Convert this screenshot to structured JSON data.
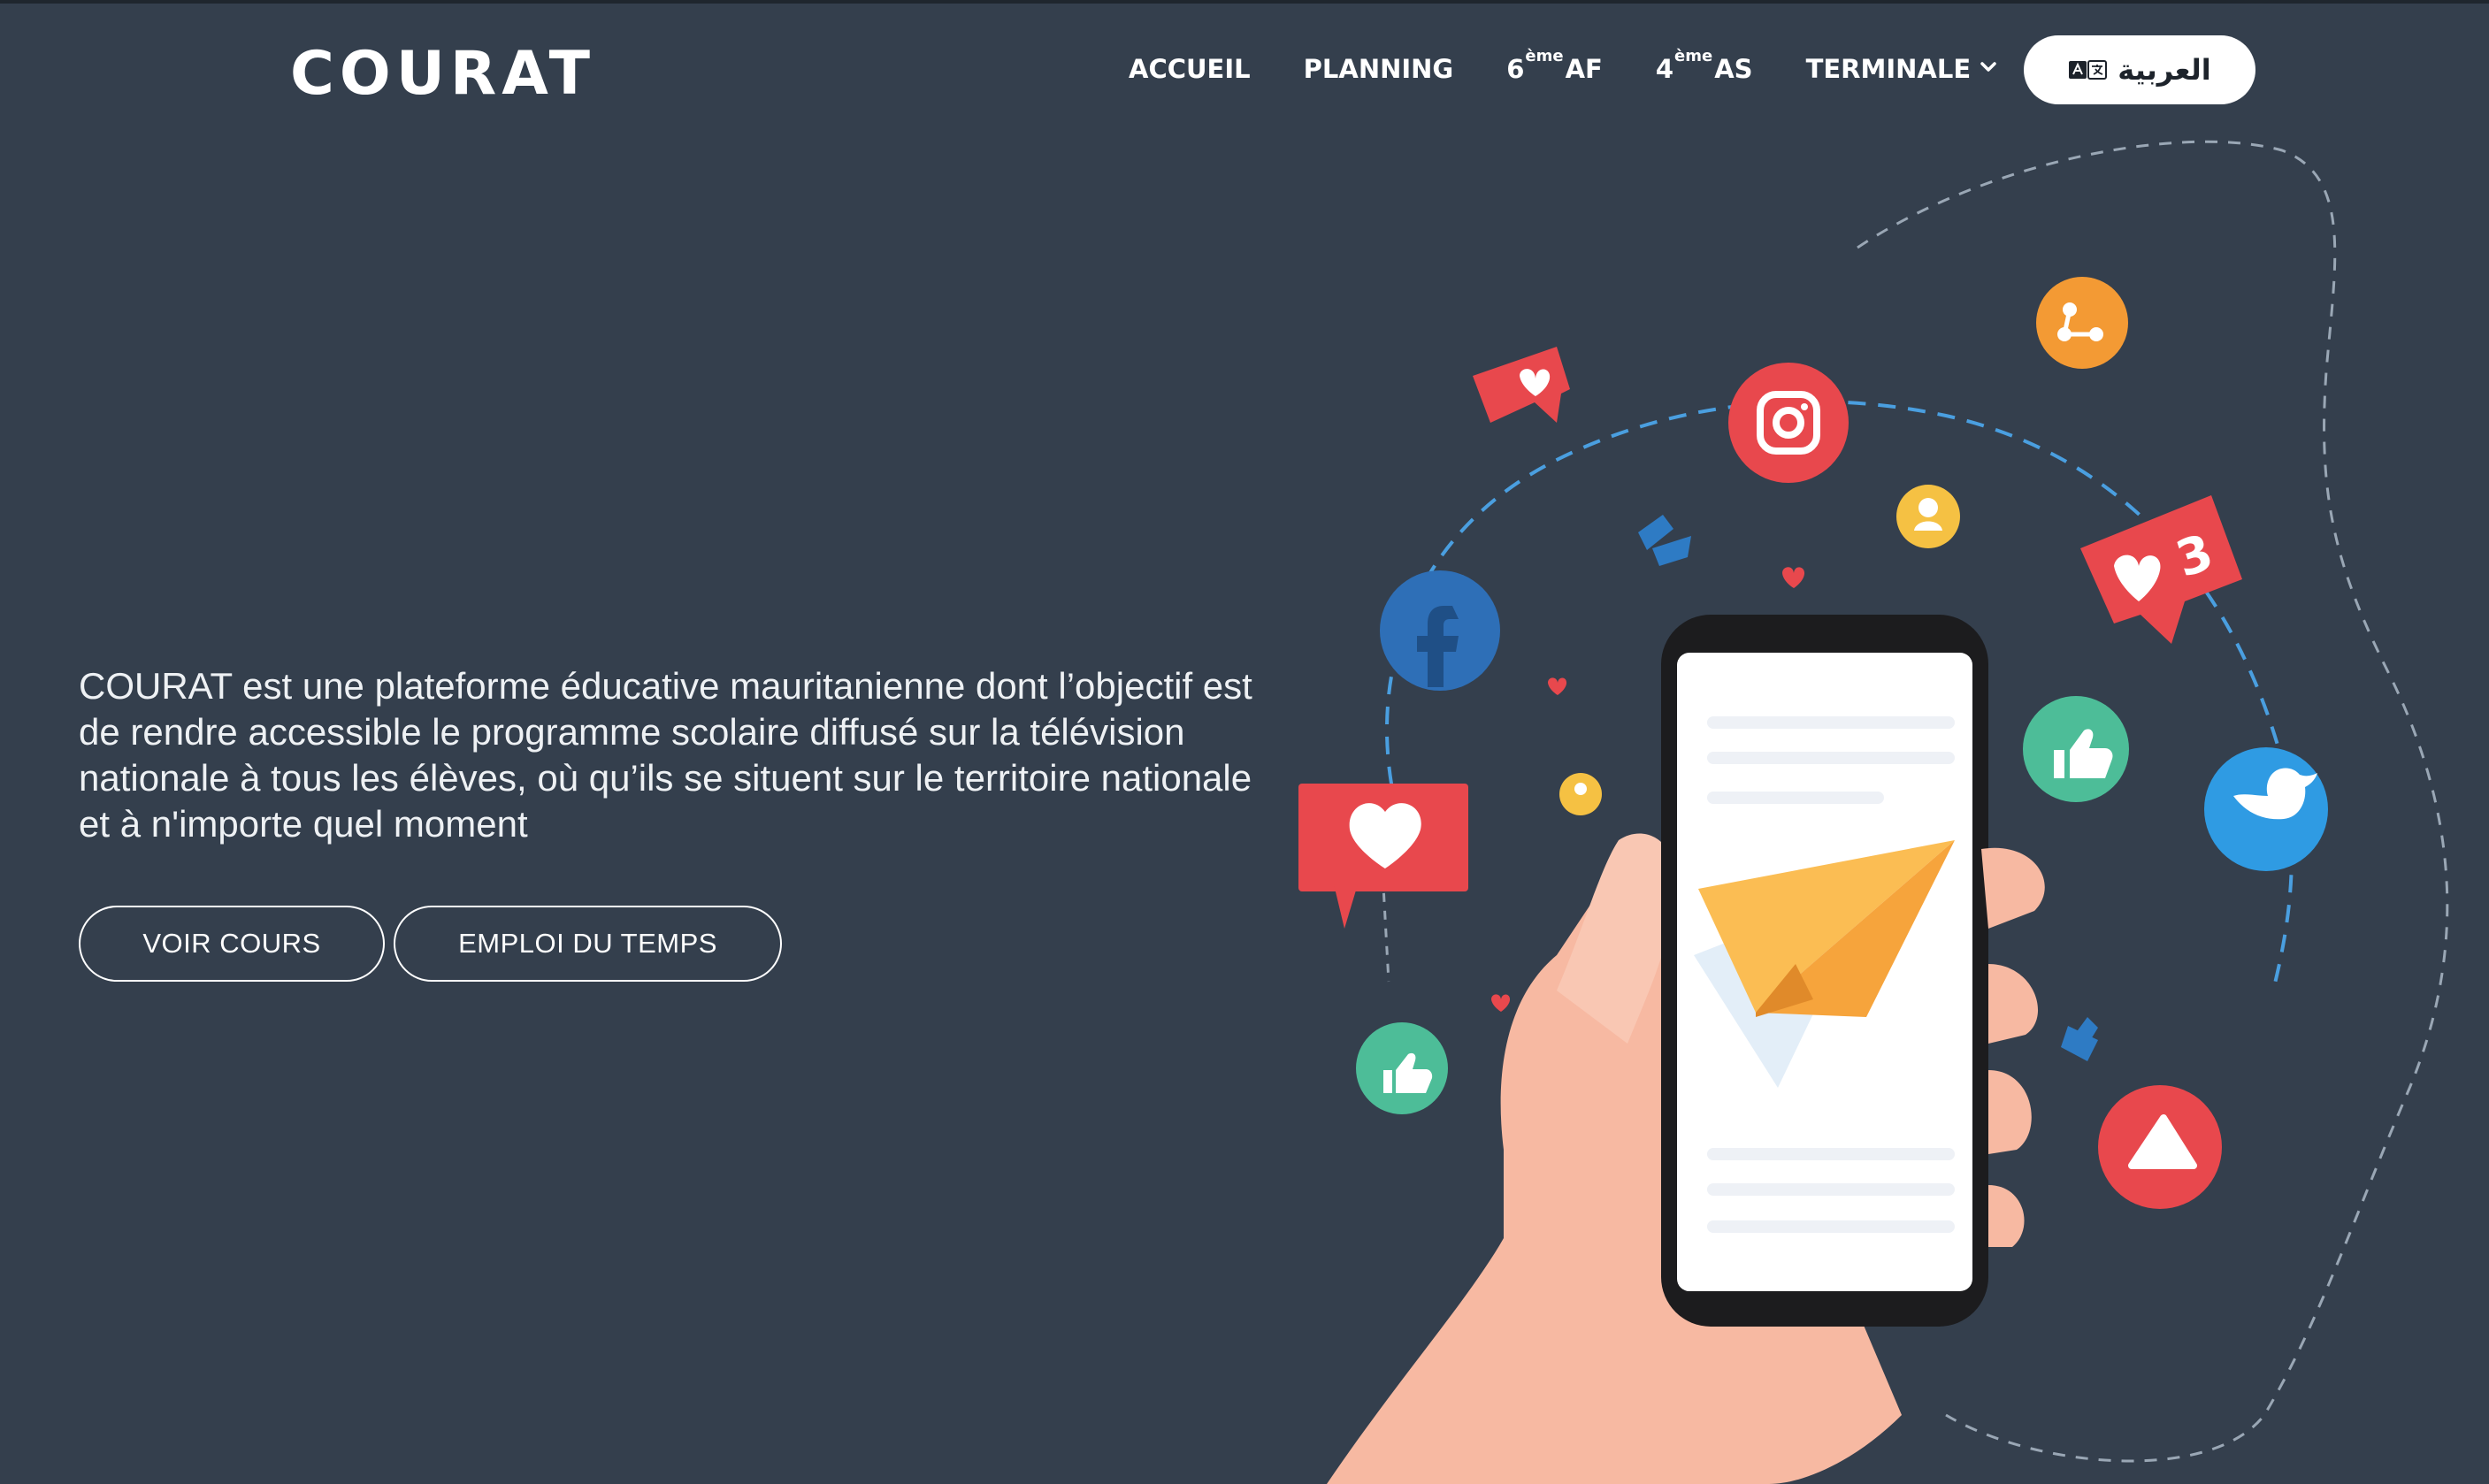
{
  "header": {
    "logo": "COURAT",
    "nav": [
      {
        "label": "ACCUEIL"
      },
      {
        "label": "PLANNING"
      },
      {
        "prefix": "6",
        "sup": "ème",
        "suffix": "AF"
      },
      {
        "prefix": "4",
        "sup": "ème",
        "suffix": "AS"
      },
      {
        "label": "TERMINALE"
      }
    ],
    "language_button": {
      "label": "العربية",
      "icon": "translate-icon"
    }
  },
  "hero": {
    "description": "COURAT est une plateforme éducative mauritanienne dont l’objectif est de rendre accessible le programme scolaire diffusé sur la télévision nationale à tous les élèves, où qu’ils se situent sur le territoire nationale et à n'importe quel moment",
    "buttons": {
      "courses": "VOIR COURS",
      "schedule": "EMPLOI DU TEMPS"
    },
    "illustration": {
      "notification_count": "3",
      "icons": [
        "facebook-icon",
        "instagram-icon",
        "twitter-icon",
        "youtube-icon",
        "share-icon",
        "thumbs-up-icon",
        "heart-icon",
        "user-icon",
        "paper-plane-icon"
      ]
    }
  },
  "colors": {
    "background": "#343f4d",
    "text": "#ffffff",
    "accent_red": "#e8484d",
    "accent_blue": "#2e7bc4",
    "accent_green": "#4dbd98",
    "accent_orange": "#f39a34"
  }
}
